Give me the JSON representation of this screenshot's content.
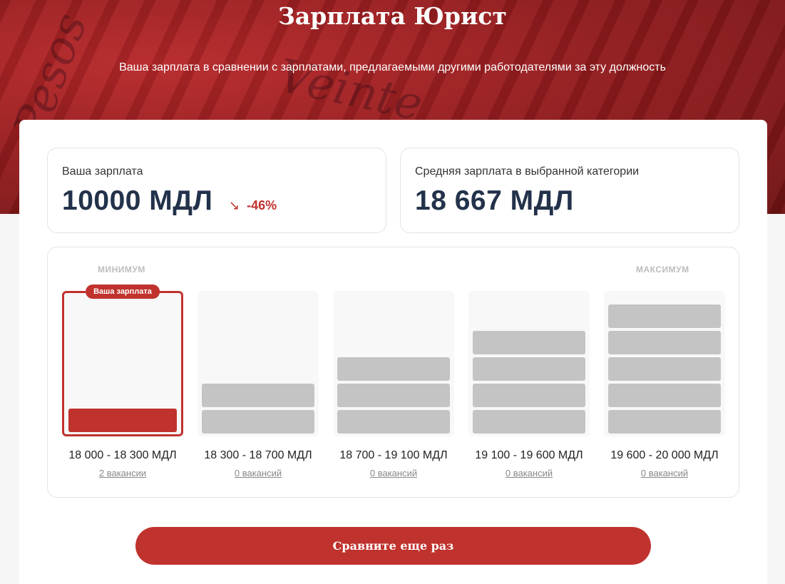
{
  "header": {
    "title": "Зарплата Юрист",
    "subtitle": "Ваша зарплата в сравнении с зарплатами, предлагаемыми другими работодателями за эту должность"
  },
  "your_salary": {
    "label": "Ваша зарплата",
    "value": "10000 МДЛ",
    "diff": "-46%",
    "diff_icon": "trend-down-arrow-icon"
  },
  "average_salary": {
    "label": "Средняя зарплата в выбранной категории",
    "value": "18 667 МДЛ"
  },
  "distribution": {
    "min_label": "МИНИМУМ",
    "max_label": "МАКСИМУМ",
    "your_badge": "Ваша зарплата",
    "buckets": [
      {
        "range": "18 000 - 18 300 МДЛ",
        "vacancies": "2 вакансии",
        "level": 1,
        "current": true
      },
      {
        "range": "18 300 - 18 700 МДЛ",
        "vacancies": "0 вакансий",
        "level": 2,
        "current": false
      },
      {
        "range": "18 700 - 19 100 МДЛ",
        "vacancies": "0 вакансий",
        "level": 3,
        "current": false
      },
      {
        "range": "19 100 - 19 600 МДЛ",
        "vacancies": "0 вакансий",
        "level": 4,
        "current": false
      },
      {
        "range": "19 600 - 20 000 МДЛ",
        "vacancies": "0 вакансий",
        "level": 5,
        "current": false
      }
    ]
  },
  "actions": {
    "compare_again": "Сравните еще раз"
  },
  "colors": {
    "accent": "#c0322d",
    "heading": "#23324a",
    "bar_inactive": "#c4c4c4"
  }
}
